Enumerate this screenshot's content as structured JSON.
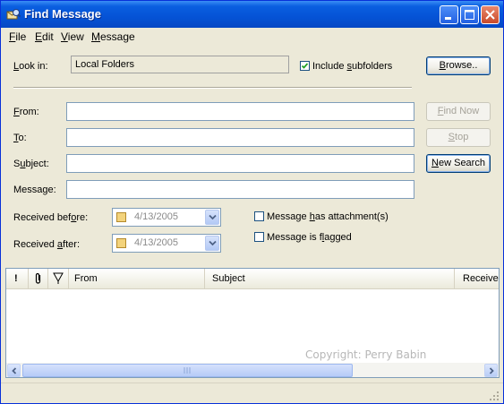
{
  "window": {
    "title": "Find Message",
    "app_icon": "find-message-icon",
    "controls": [
      "minimize-icon",
      "maximize-icon",
      "close-icon"
    ]
  },
  "menu": {
    "items": [
      {
        "key": "F",
        "rest": "ile"
      },
      {
        "key": "E",
        "rest": "dit"
      },
      {
        "key": "V",
        "rest": "iew"
      },
      {
        "key": "M",
        "rest": "essage"
      }
    ]
  },
  "lookin": {
    "label_key": "L",
    "label_rest": "ook in:",
    "value": "Local Folders",
    "include_pre": "Include ",
    "include_key": "s",
    "include_rest": "ubfolders",
    "include_checked": true,
    "browse_key": "B",
    "browse_rest": "rowse.."
  },
  "fields": [
    {
      "key": "F",
      "rest": "rom:",
      "value": ""
    },
    {
      "key": "T",
      "rest": "o:",
      "value": ""
    },
    {
      "pre": "S",
      "key": "u",
      "rest": "bject:",
      "value": ""
    },
    {
      "pre": "Message:",
      "key": "",
      "rest": "",
      "value": ""
    }
  ],
  "buttons": {
    "find_now": {
      "key": "F",
      "rest": "ind Now",
      "enabled": false
    },
    "stop": {
      "key": "S",
      "rest": "top",
      "enabled": false
    },
    "new_search": {
      "key": "N",
      "rest": "ew Search",
      "enabled": true
    }
  },
  "dates": {
    "before": {
      "pre": "Received bef",
      "key": "o",
      "rest": "re:",
      "value": "4/13/2005",
      "checked": false
    },
    "after": {
      "pre": "Received ",
      "key": "a",
      "rest": "fter:",
      "value": "4/13/2005",
      "checked": false
    }
  },
  "options": {
    "attachment": {
      "pre": "Message ",
      "key": "h",
      "rest": "as attachment(s)",
      "checked": false
    },
    "flagged": {
      "pre": "Message is f",
      "key": "l",
      "rest": "agged",
      "checked": false
    }
  },
  "results": {
    "columns": [
      {
        "label": "!",
        "icon": "priority-icon"
      },
      {
        "label": "",
        "icon": "attachment-icon"
      },
      {
        "label": "",
        "icon": "flag-icon"
      },
      {
        "label": "From"
      },
      {
        "label": "Subject"
      },
      {
        "label": "Received"
      }
    ],
    "rows": [],
    "watermark": "Copyright: Perry Babin"
  },
  "colors": {
    "titlebar": "#0553d6",
    "window_bg": "#ece9d8",
    "input_border": "#7f9db9"
  }
}
